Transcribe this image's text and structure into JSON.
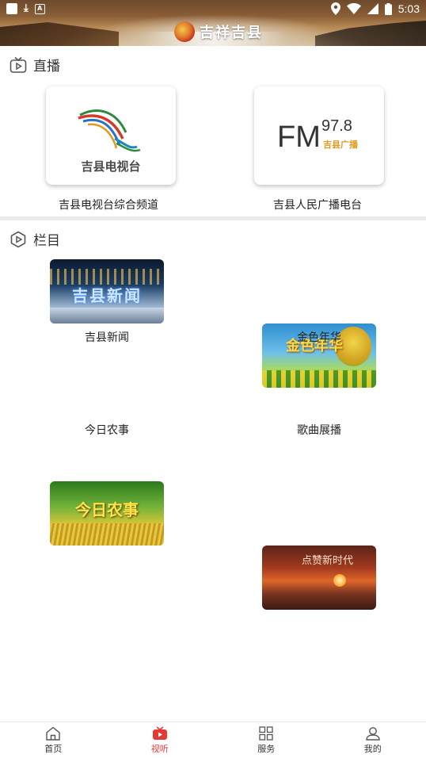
{
  "status_bar": {
    "time": "5:03"
  },
  "header": {
    "logo_text": "吉祥吉县"
  },
  "live_section": {
    "title": "直播",
    "items": [
      {
        "caption": "吉县电视台综合频道",
        "logo_text": "吉县电视台"
      },
      {
        "caption": "吉县人民广播电台",
        "logo_text": "FM",
        "logo_freq": "97.8",
        "logo_sub": "吉县广播"
      }
    ]
  },
  "columns_section": {
    "title": "栏目",
    "items": [
      {
        "caption": "吉县新闻",
        "thumb_text": "吉县新闻"
      },
      {
        "caption": "金色年华",
        "thumb_text": "金色年华"
      },
      {
        "caption": "今日农事",
        "thumb_text": "今日农事"
      },
      {
        "caption": "歌曲展播",
        "thumb_text": "点赞新时代"
      }
    ]
  },
  "bottom_nav": {
    "items": [
      {
        "label": "首页",
        "icon": "home-icon"
      },
      {
        "label": "视听",
        "icon": "tv-icon",
        "active": true
      },
      {
        "label": "服务",
        "icon": "grid-icon"
      },
      {
        "label": "我的",
        "icon": "user-icon"
      }
    ]
  },
  "colors": {
    "accent": "#e53935",
    "divider": "#ececec",
    "text": "#222222"
  }
}
